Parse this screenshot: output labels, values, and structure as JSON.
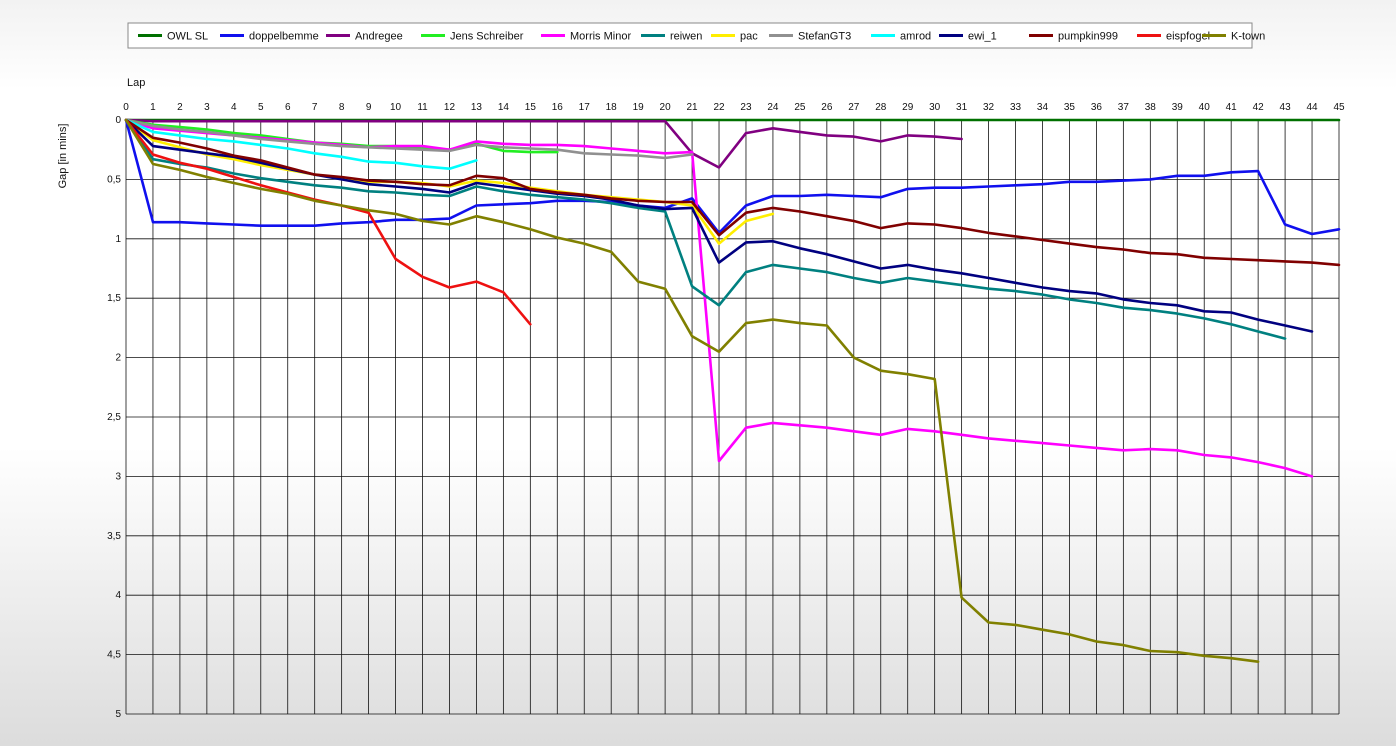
{
  "chart_data": {
    "type": "line",
    "xlabel": "Lap",
    "ylabel": "Gap [in mins]",
    "xlim": [
      0,
      45
    ],
    "ylim": [
      0,
      5
    ],
    "y_inverted": true,
    "grid": true,
    "legend_position": "top",
    "x_ticks": [
      "0",
      "1",
      "2",
      "3",
      "4",
      "5",
      "6",
      "7",
      "8",
      "9",
      "10",
      "11",
      "12",
      "13",
      "14",
      "15",
      "16",
      "17",
      "18",
      "19",
      "20",
      "21",
      "22",
      "23",
      "24",
      "25",
      "26",
      "27",
      "28",
      "29",
      "30",
      "31",
      "32",
      "33",
      "34",
      "35",
      "36",
      "37",
      "38",
      "39",
      "40",
      "41",
      "42",
      "43",
      "44",
      "45"
    ],
    "y_ticks": [
      {
        "value": 0,
        "label": "0"
      },
      {
        "value": 0.5,
        "label": "0,5"
      },
      {
        "value": 1,
        "label": "1"
      },
      {
        "value": 1.5,
        "label": "1,5"
      },
      {
        "value": 2,
        "label": "2"
      },
      {
        "value": 2.5,
        "label": "2,5"
      },
      {
        "value": 3,
        "label": "3"
      },
      {
        "value": 3.5,
        "label": "3,5"
      },
      {
        "value": 4,
        "label": "4"
      },
      {
        "value": 4.5,
        "label": "4,5"
      },
      {
        "value": 5,
        "label": "5"
      }
    ],
    "series": [
      {
        "name": "OWL SL",
        "color": "#007000",
        "start": 0,
        "values": [
          0,
          0,
          0,
          0,
          0,
          0,
          0,
          0,
          0,
          0,
          0,
          0,
          0,
          0,
          0,
          0,
          0,
          0,
          0,
          0,
          0,
          0,
          0,
          0,
          0,
          0,
          0,
          0,
          0,
          0,
          0,
          0,
          0,
          0,
          0,
          0,
          0,
          0,
          0,
          0,
          0,
          0,
          0,
          0,
          0,
          0
        ]
      },
      {
        "name": "doppelbemme",
        "color": "#1010ee",
        "start": 0,
        "values": [
          0,
          0.86,
          0.86,
          0.87,
          0.88,
          0.89,
          0.89,
          0.89,
          0.87,
          0.86,
          0.84,
          0.84,
          0.83,
          0.72,
          0.71,
          0.7,
          0.68,
          0.68,
          0.69,
          0.72,
          0.74,
          0.66,
          0.95,
          0.72,
          0.64,
          0.64,
          0.63,
          0.64,
          0.65,
          0.58,
          0.57,
          0.57,
          0.56,
          0.55,
          0.54,
          0.52,
          0.52,
          0.51,
          0.5,
          0.47,
          0.47,
          0.44,
          0.43,
          0.88,
          0.96,
          0.92
        ]
      },
      {
        "name": "Andregee",
        "color": "#800080",
        "start": 0,
        "values": [
          0,
          0.01,
          0.01,
          0.01,
          0.01,
          0.01,
          0.01,
          0.01,
          0.01,
          0.01,
          0.01,
          0.01,
          0.01,
          0.01,
          0.01,
          0.01,
          0.01,
          0.01,
          0.01,
          0.01,
          0.01,
          0.28,
          0.4,
          0.11,
          0.07,
          0.1,
          0.13,
          0.14,
          0.18,
          0.13,
          0.14,
          0.16
        ]
      },
      {
        "name": "Jens Schreiber",
        "color": "#22ee22",
        "start": 0,
        "values": [
          0,
          0.04,
          0.06,
          0.08,
          0.11,
          0.13,
          0.16,
          0.19,
          0.2,
          0.22,
          0.22,
          0.24,
          0.25,
          0.2,
          0.26,
          0.27,
          0.27
        ]
      },
      {
        "name": "Morris Minor",
        "color": "#ff00ff",
        "start": 0,
        "values": [
          0,
          0.07,
          0.09,
          0.11,
          0.13,
          0.15,
          0.17,
          0.19,
          0.21,
          0.23,
          0.22,
          0.22,
          0.25,
          0.18,
          0.2,
          0.21,
          0.21,
          0.22,
          0.24,
          0.26,
          0.28,
          0.27,
          2.87,
          2.59,
          2.55,
          2.57,
          2.59,
          2.62,
          2.65,
          2.6,
          2.62,
          2.65,
          2.68,
          2.7,
          2.72,
          2.74,
          2.76,
          2.78,
          2.77,
          2.78,
          2.82,
          2.84,
          2.88,
          2.93,
          3.0
        ]
      },
      {
        "name": "reiwen",
        "color": "#008080",
        "start": 0,
        "values": [
          0,
          0.33,
          0.37,
          0.4,
          0.45,
          0.49,
          0.52,
          0.55,
          0.57,
          0.6,
          0.61,
          0.63,
          0.64,
          0.56,
          0.6,
          0.63,
          0.65,
          0.67,
          0.7,
          0.74,
          0.77,
          1.4,
          1.56,
          1.28,
          1.22,
          1.25,
          1.28,
          1.33,
          1.37,
          1.33,
          1.36,
          1.39,
          1.42,
          1.44,
          1.47,
          1.51,
          1.54,
          1.58,
          1.6,
          1.63,
          1.67,
          1.72,
          1.78,
          1.84
        ]
      },
      {
        "name": "pac",
        "color": "#ffee00",
        "start": 0,
        "values": [
          0,
          0.17,
          0.23,
          0.29,
          0.33,
          0.38,
          0.42,
          0.46,
          0.49,
          0.52,
          0.52,
          0.53,
          0.56,
          0.51,
          0.53,
          0.57,
          0.6,
          0.63,
          0.65,
          0.67,
          0.69,
          0.72,
          1.04,
          0.85,
          0.79
        ]
      },
      {
        "name": "StefanGT3",
        "color": "#909090",
        "start": 0,
        "values": [
          0,
          0.05,
          0.08,
          0.1,
          0.13,
          0.16,
          0.18,
          0.2,
          0.22,
          0.23,
          0.24,
          0.25,
          0.26,
          0.21,
          0.23,
          0.24,
          0.25,
          0.28,
          0.29,
          0.3,
          0.32,
          0.29
        ]
      },
      {
        "name": "amrod",
        "color": "#00ffff",
        "start": 0,
        "values": [
          0,
          0.1,
          0.13,
          0.16,
          0.18,
          0.21,
          0.24,
          0.28,
          0.31,
          0.35,
          0.36,
          0.39,
          0.41,
          0.34
        ]
      },
      {
        "name": "ewi_1",
        "color": "#000080",
        "start": 0,
        "values": [
          0,
          0.22,
          0.25,
          0.28,
          0.31,
          0.36,
          0.41,
          0.46,
          0.5,
          0.54,
          0.56,
          0.58,
          0.61,
          0.53,
          0.56,
          0.59,
          0.62,
          0.64,
          0.67,
          0.72,
          0.75,
          0.74,
          1.2,
          1.03,
          1.02,
          1.08,
          1.13,
          1.19,
          1.25,
          1.22,
          1.26,
          1.29,
          1.33,
          1.37,
          1.41,
          1.44,
          1.46,
          1.51,
          1.54,
          1.56,
          1.61,
          1.62,
          1.68,
          1.73,
          1.78
        ]
      },
      {
        "name": "pumpkin999",
        "color": "#800000",
        "start": 0,
        "values": [
          0,
          0.15,
          0.19,
          0.24,
          0.3,
          0.34,
          0.4,
          0.46,
          0.48,
          0.51,
          0.52,
          0.54,
          0.55,
          0.47,
          0.49,
          0.58,
          0.61,
          0.63,
          0.66,
          0.68,
          0.69,
          0.69,
          0.97,
          0.78,
          0.74,
          0.77,
          0.81,
          0.85,
          0.91,
          0.87,
          0.88,
          0.91,
          0.95,
          0.98,
          1.01,
          1.04,
          1.07,
          1.09,
          1.12,
          1.13,
          1.16,
          1.17,
          1.18,
          1.19,
          1.2,
          1.22
        ]
      },
      {
        "name": "eispfogel",
        "color": "#ee1111",
        "start": 0,
        "values": [
          0,
          0.29,
          0.36,
          0.41,
          0.48,
          0.55,
          0.61,
          0.67,
          0.72,
          0.78,
          1.17,
          1.32,
          1.41,
          1.36,
          1.45,
          1.72
        ]
      },
      {
        "name": "K-town",
        "color": "#808000",
        "start": 0,
        "values": [
          0,
          0.37,
          0.42,
          0.48,
          0.53,
          0.58,
          0.62,
          0.68,
          0.72,
          0.76,
          0.79,
          0.85,
          0.88,
          0.81,
          0.86,
          0.92,
          0.99,
          1.04,
          1.11,
          1.36,
          1.42,
          1.82,
          1.95,
          1.71,
          1.68,
          1.71,
          1.73,
          2.0,
          2.11,
          2.14,
          2.18,
          4.02,
          4.23,
          4.25,
          4.29,
          4.33,
          4.39,
          4.42,
          4.47,
          4.48,
          4.51,
          4.53,
          4.56
        ]
      }
    ]
  }
}
